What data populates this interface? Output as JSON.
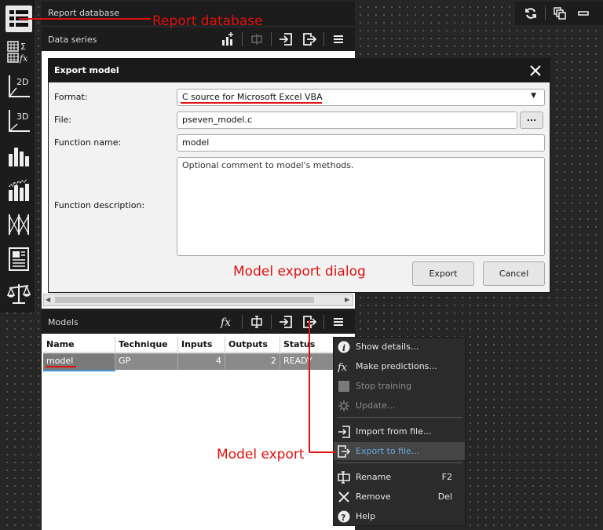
{
  "report_database": {
    "title": "Report database"
  },
  "data_series": {
    "title": "Data series"
  },
  "models_panel": {
    "title": "Models",
    "columns": [
      "Name",
      "Technique",
      "Inputs",
      "Outputs",
      "Status"
    ],
    "rows": [
      [
        "model",
        "GP",
        "4",
        "2",
        "READY"
      ]
    ]
  },
  "dialog": {
    "title": "Export model",
    "format_label": "Format:",
    "format_value": "C source for Microsoft Excel VBA",
    "file_label": "File:",
    "file_value": "pseven_model.c",
    "browse_label": "...",
    "function_name_label": "Function name:",
    "function_name_value": "model",
    "function_description_label": "Function description:",
    "function_description_placeholder": "Optional comment to model's methods.",
    "export_button": "Export",
    "cancel_button": "Cancel"
  },
  "context_menu": {
    "items": [
      {
        "label": "Show details...",
        "icon": "info-icon",
        "shortcut": ""
      },
      {
        "label": "Make predictions...",
        "icon": "fx-icon",
        "shortcut": ""
      },
      {
        "label": "Stop training",
        "icon": "stop-icon",
        "shortcut": ""
      },
      {
        "label": "Update...",
        "icon": "gear-icon",
        "shortcut": ""
      },
      {
        "label": "Import from file...",
        "icon": "import-icon",
        "shortcut": ""
      },
      {
        "label": "Export to file...",
        "icon": "export-icon",
        "shortcut": ""
      },
      {
        "label": "Rename",
        "icon": "rename-icon",
        "shortcut": "F2"
      },
      {
        "label": "Remove",
        "icon": "close-icon",
        "shortcut": "Del"
      },
      {
        "label": "Help",
        "icon": "help-icon",
        "shortcut": ""
      }
    ]
  },
  "left_toolbar": {
    "items": [
      "report-database-icon",
      "table-sigma-fx-icon",
      "plot-2d-icon",
      "plot-3d-icon",
      "bar-chart-icon",
      "scatter-matrix-icon",
      "parallel-coordinates-icon",
      "document-icon",
      "balance-icon"
    ],
    "plot_2d_label": "2D",
    "plot_3d_label": "3D"
  },
  "annotations": {
    "report_database": "Report database",
    "model_export_dialog": "Model export dialog",
    "model_export": "Model export"
  },
  "colors": {
    "annotation": "#e01010",
    "highlight_text": "#6aa6e0",
    "dark_panel": "#1c1c1c"
  }
}
